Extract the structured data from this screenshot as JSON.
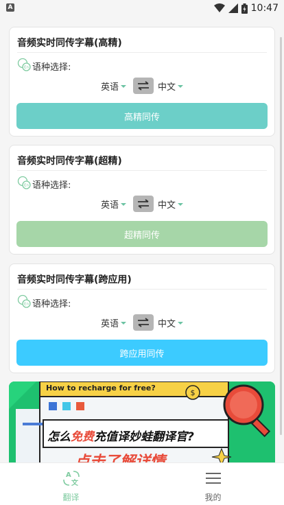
{
  "status_bar": {
    "time": "10:47",
    "app_badge": "A"
  },
  "cards": [
    {
      "title": "音频实时同传字幕(高精)",
      "lang_label": "语种选择:",
      "source_lang": "英语",
      "target_lang": "中文",
      "button": "高精同传",
      "button_color": "#6ccfc8"
    },
    {
      "title": "音频实时同传字幕(超精)",
      "lang_label": "语种选择:",
      "source_lang": "英语",
      "target_lang": "中文",
      "button": "超精同传",
      "button_color": "#a6d6a8"
    },
    {
      "title": "音频实时同传字幕(跨应用)",
      "lang_label": "语种选择:",
      "source_lang": "英语",
      "target_lang": "中文",
      "button": "跨应用同传",
      "button_color": "#3ccbff"
    }
  ],
  "banner": {
    "question": "How to recharge for free?",
    "headline_prefix": "怎么",
    "headline_highlight": "免费",
    "headline_suffix": "充值译妙蛙翻译官?",
    "cta": "点击了解详情"
  },
  "tabs": [
    {
      "label": "翻译",
      "active": true,
      "color": "#7fcba0"
    },
    {
      "label": "我的",
      "active": false,
      "color": "#666666"
    }
  ]
}
